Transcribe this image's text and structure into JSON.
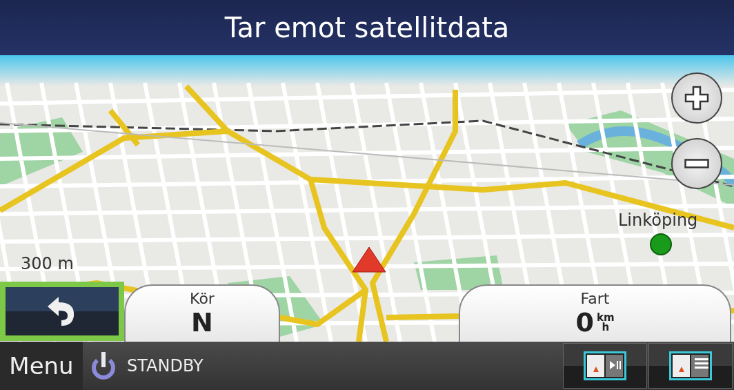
{
  "title": "Tar emot satellitdata",
  "map": {
    "scale": "300 m",
    "places": [
      {
        "name": "Linköping"
      }
    ]
  },
  "zoom_controls": [
    {
      "kind": "plus"
    },
    {
      "kind": "minus"
    }
  ],
  "back_button": {
    "highlighted": true
  },
  "info_panels": [
    {
      "label": "Kör",
      "value": "N"
    },
    {
      "label": "Fart",
      "value": "0",
      "unit_top": "km",
      "unit_bottom": "h"
    }
  ],
  "bottom_bar": {
    "menu": "Menu",
    "status": "STANDBY",
    "buttons": [
      {
        "kind": "play"
      },
      {
        "kind": "list"
      }
    ]
  }
}
